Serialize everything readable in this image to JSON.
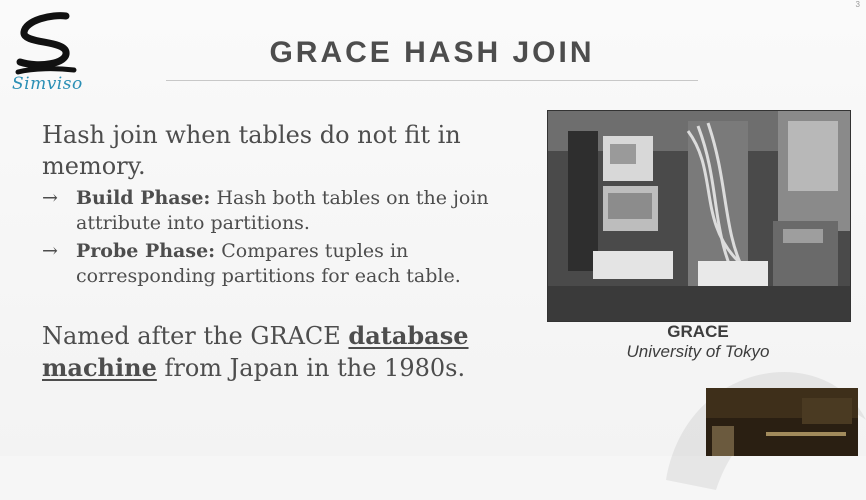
{
  "slide": {
    "title": "GRACE HASH JOIN",
    "page_number": "3"
  },
  "logo": {
    "text": "Simviso"
  },
  "content": {
    "lead": "Hash join when tables do not fit in memory.",
    "bullets": [
      {
        "term": "Build Phase:",
        "text": " Hash both tables on the join attribute into partitions."
      },
      {
        "term": "Probe Phase:",
        "text": " Compares tuples in corresponding partitions for each table."
      }
    ],
    "named": {
      "prefix": "Named after the GRACE ",
      "link": "database machine",
      "suffix": " from Japan in the 1980s."
    }
  },
  "figure": {
    "caption_title": "GRACE",
    "caption_sub": "University of Tokyo"
  },
  "colors": {
    "text": "#4d4d4d",
    "logo_accent": "#2a8fb5",
    "background": "#f6f6f6"
  }
}
